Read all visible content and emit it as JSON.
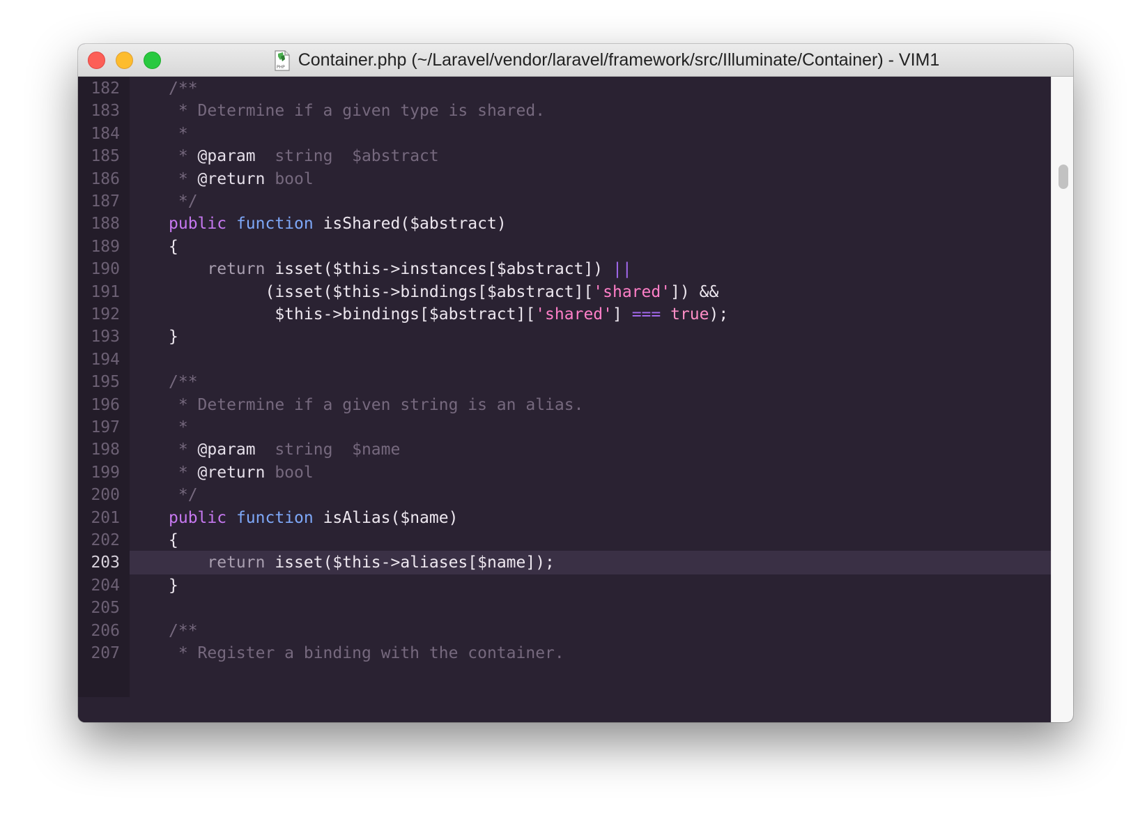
{
  "window": {
    "title": "Container.php (~/Laravel/vendor/laravel/framework/src/Illuminate/Container) - VIM1",
    "file_icon": "php-file-icon",
    "file_icon_label": "PHP"
  },
  "editor": {
    "current_line": "203",
    "lines": [
      {
        "num": "182",
        "tokens": [
          {
            "t": "/**",
            "c": "comment"
          }
        ]
      },
      {
        "num": "183",
        "tokens": [
          {
            "t": " * Determine if a given type is shared.",
            "c": "comment"
          }
        ]
      },
      {
        "num": "184",
        "tokens": [
          {
            "t": " *",
            "c": "comment"
          }
        ]
      },
      {
        "num": "185",
        "tokens": [
          {
            "t": " * ",
            "c": "comment"
          },
          {
            "t": "@param",
            "c": "tag"
          },
          {
            "t": "  string  $abstract",
            "c": "comment"
          }
        ]
      },
      {
        "num": "186",
        "tokens": [
          {
            "t": " * ",
            "c": "comment"
          },
          {
            "t": "@return",
            "c": "tag"
          },
          {
            "t": " bool",
            "c": "comment"
          }
        ]
      },
      {
        "num": "187",
        "tokens": [
          {
            "t": " */",
            "c": "comment"
          }
        ]
      },
      {
        "num": "188",
        "tokens": [
          {
            "t": "public",
            "c": "kw"
          },
          {
            "t": " ",
            "c": "plain"
          },
          {
            "t": "function",
            "c": "kw2"
          },
          {
            "t": " isShared($abstract)",
            "c": "fn"
          }
        ]
      },
      {
        "num": "189",
        "tokens": [
          {
            "t": "{",
            "c": "plain"
          }
        ]
      },
      {
        "num": "190",
        "tokens": [
          {
            "t": "    ",
            "c": "plain"
          },
          {
            "t": "return",
            "c": "ret"
          },
          {
            "t": " isset($this->instances[$abstract]) ",
            "c": "plain"
          },
          {
            "t": "||",
            "c": "op"
          }
        ]
      },
      {
        "num": "191",
        "tokens": [
          {
            "t": "          (isset($this->bindings[$abstract][",
            "c": "plain"
          },
          {
            "t": "'shared'",
            "c": "str"
          },
          {
            "t": "]) ",
            "c": "plain"
          },
          {
            "t": "&&",
            "c": "plain"
          }
        ]
      },
      {
        "num": "192",
        "tokens": [
          {
            "t": "           $this->bindings[$abstract][",
            "c": "plain"
          },
          {
            "t": "'shared'",
            "c": "str"
          },
          {
            "t": "] ",
            "c": "plain"
          },
          {
            "t": "===",
            "c": "op"
          },
          {
            "t": " ",
            "c": "plain"
          },
          {
            "t": "true",
            "c": "bool"
          },
          {
            "t": ");",
            "c": "plain"
          }
        ]
      },
      {
        "num": "193",
        "tokens": [
          {
            "t": "}",
            "c": "plain"
          }
        ]
      },
      {
        "num": "194",
        "tokens": []
      },
      {
        "num": "195",
        "tokens": [
          {
            "t": "/**",
            "c": "comment"
          }
        ]
      },
      {
        "num": "196",
        "tokens": [
          {
            "t": " * Determine if a given string is an alias.",
            "c": "comment"
          }
        ]
      },
      {
        "num": "197",
        "tokens": [
          {
            "t": " *",
            "c": "comment"
          }
        ]
      },
      {
        "num": "198",
        "tokens": [
          {
            "t": " * ",
            "c": "comment"
          },
          {
            "t": "@param",
            "c": "tag"
          },
          {
            "t": "  string  $name",
            "c": "comment"
          }
        ]
      },
      {
        "num": "199",
        "tokens": [
          {
            "t": " * ",
            "c": "comment"
          },
          {
            "t": "@return",
            "c": "tag"
          },
          {
            "t": " bool",
            "c": "comment"
          }
        ]
      },
      {
        "num": "200",
        "tokens": [
          {
            "t": " */",
            "c": "comment"
          }
        ]
      },
      {
        "num": "201",
        "tokens": [
          {
            "t": "public",
            "c": "kw"
          },
          {
            "t": " ",
            "c": "plain"
          },
          {
            "t": "function",
            "c": "kw2"
          },
          {
            "t": " isAlias($name)",
            "c": "fn"
          }
        ]
      },
      {
        "num": "202",
        "tokens": [
          {
            "t": "{",
            "c": "plain"
          }
        ]
      },
      {
        "num": "203",
        "tokens": [
          {
            "t": "    ",
            "c": "plain"
          },
          {
            "t": "return",
            "c": "ret"
          },
          {
            "t": " isset($this->aliases[$name]);",
            "c": "plain"
          }
        ]
      },
      {
        "num": "204",
        "tokens": [
          {
            "t": "}",
            "c": "plain"
          }
        ]
      },
      {
        "num": "205",
        "tokens": []
      },
      {
        "num": "206",
        "tokens": [
          {
            "t": "/**",
            "c": "comment"
          }
        ]
      },
      {
        "num": "207",
        "tokens": [
          {
            "t": " * Register a binding with the container.",
            "c": "comment"
          }
        ]
      }
    ]
  },
  "colors": {
    "background": "#2a2232",
    "gutter": "#231c29",
    "current_line": "#3a3045",
    "comment": "#76697e",
    "keyword_public": "#c678f0",
    "keyword_function": "#7ea8f8",
    "string": "#ff7fc8"
  }
}
